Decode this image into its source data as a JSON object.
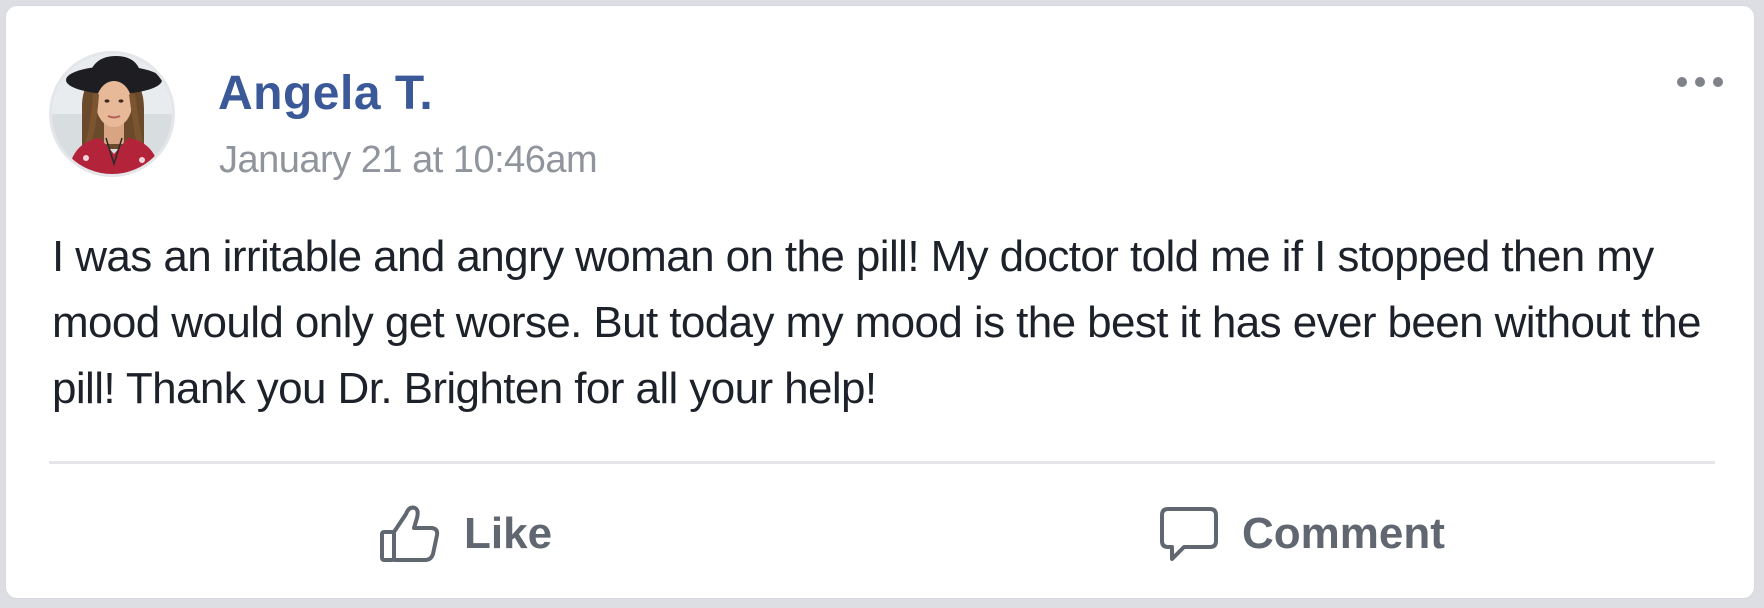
{
  "post": {
    "author": {
      "name": "Angela T.",
      "avatar_alt": "Angela T."
    },
    "timestamp": "January 21 at 10:46am",
    "body": "I was an irritable and angry woman on the pill! My doctor told me if I stopped then my mood would only get worse. But today my mood is the best it has ever been without the pill! Thank you Dr. Brighten for all your help!",
    "actions": {
      "like_label": "Like",
      "comment_label": "Comment"
    }
  },
  "colors": {
    "author_name": "#3b5998",
    "timestamp": "#90949c",
    "body_text": "#1d2129",
    "action_text": "#616770",
    "divider": "#e5e6e9"
  },
  "icons": {
    "more": "more-dots-icon",
    "like": "thumbs-up-icon",
    "comment": "speech-bubble-icon"
  }
}
